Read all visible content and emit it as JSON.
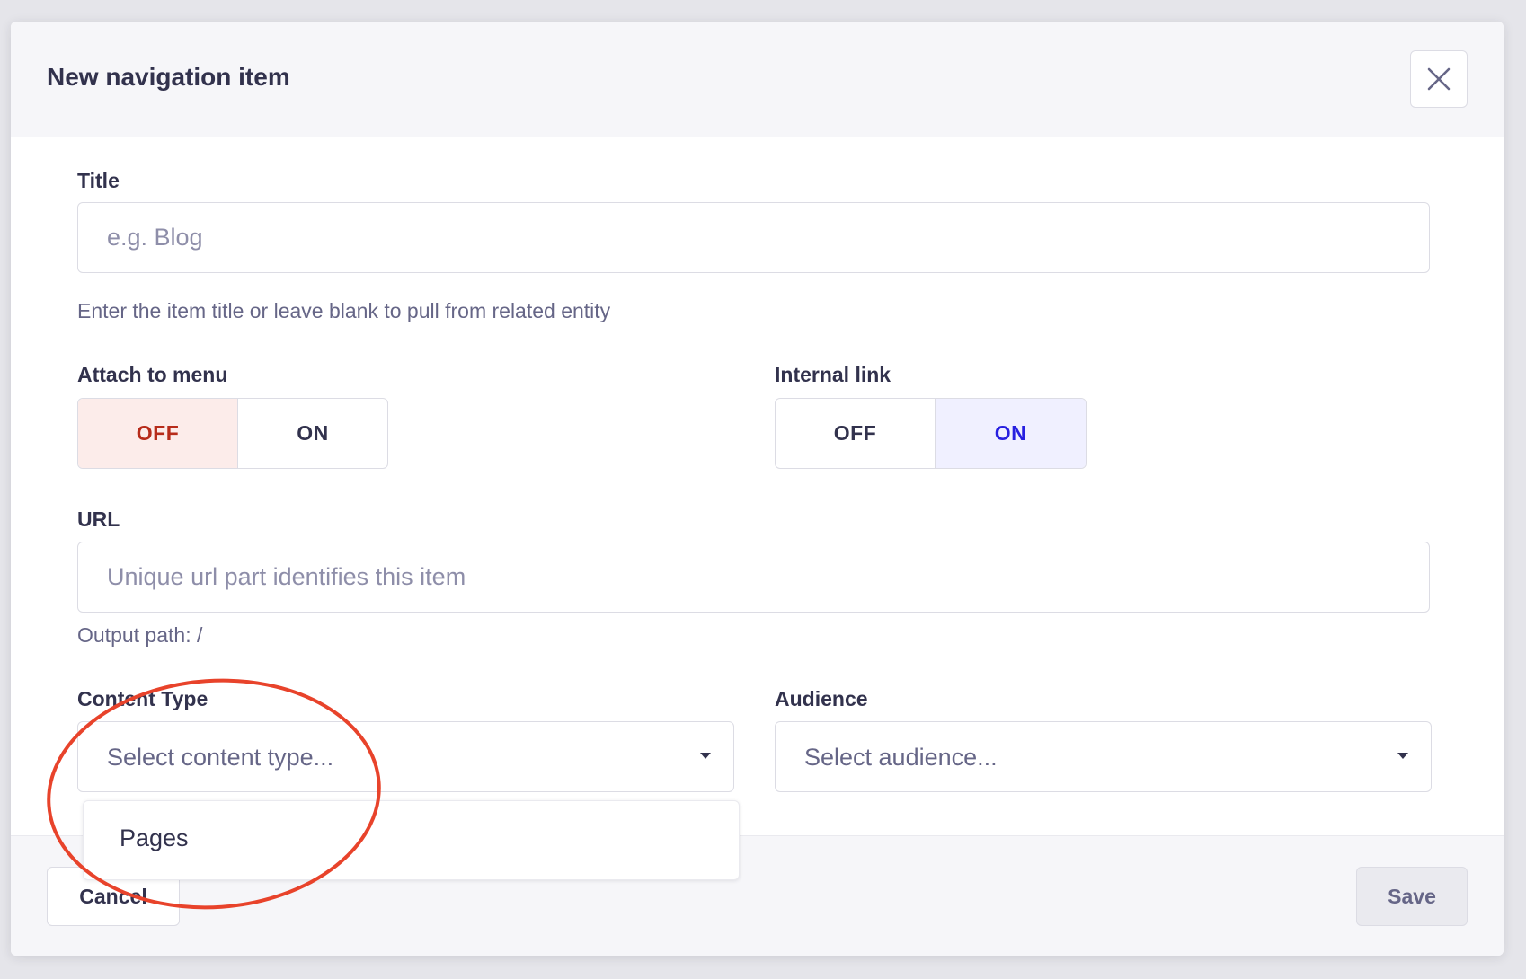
{
  "modal": {
    "title": "New navigation item",
    "close_icon": "close-icon"
  },
  "fields": {
    "title": {
      "label": "Title",
      "placeholder": "e.g. Blog",
      "value": "",
      "hint": "Enter the item title or leave blank to pull from related entity"
    },
    "attach_to_menu": {
      "label": "Attach to menu",
      "off_label": "OFF",
      "on_label": "ON",
      "selected": "OFF"
    },
    "internal_link": {
      "label": "Internal link",
      "off_label": "OFF",
      "on_label": "ON",
      "selected": "ON"
    },
    "url": {
      "label": "URL",
      "placeholder": "Unique url part identifies this item",
      "value": "",
      "hint": "Output path: /"
    },
    "content_type": {
      "label": "Content Type",
      "placeholder": "Select content type...",
      "options": [
        "Pages"
      ]
    },
    "audience": {
      "label": "Audience",
      "placeholder": "Select audience..."
    }
  },
  "footer": {
    "cancel_label": "Cancel",
    "save_label": "Save"
  },
  "colors": {
    "primary": "#271fe0",
    "danger": "#b72b1a",
    "annotation": "#e8432b",
    "neutral_bg": "#f6f6f9"
  }
}
